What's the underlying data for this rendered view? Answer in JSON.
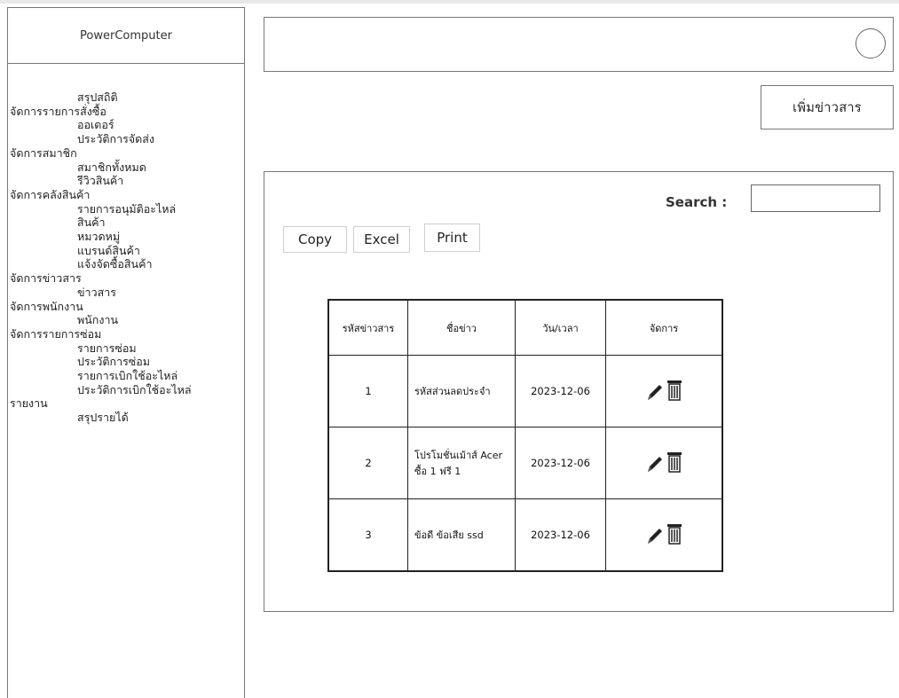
{
  "sidebar": {
    "brand": "PowerComputer",
    "menu": [
      {
        "label": "สรุปสถิติ",
        "level": "sub"
      },
      {
        "label": "จัดการรายการสั่งซื้อ",
        "level": "grp"
      },
      {
        "label": "ออเดอร์",
        "level": "sub"
      },
      {
        "label": "ประวัติการจัดส่ง",
        "level": "sub"
      },
      {
        "label": "จัดการสมาชิก",
        "level": "grp"
      },
      {
        "label": "สมาชิกทั้งหมด",
        "level": "sub"
      },
      {
        "label": "รีวิวสินค้า",
        "level": "sub"
      },
      {
        "label": "จัดการคลังสินค้า",
        "level": "grp"
      },
      {
        "label": "รายการอนุมัติอะไหล่",
        "level": "sub"
      },
      {
        "label": "สินค้า",
        "level": "sub"
      },
      {
        "label": "หมวดหมู่",
        "level": "sub"
      },
      {
        "label": "แบรนด์สินค้า",
        "level": "sub"
      },
      {
        "label": "แจ้งจัดซื้อสินค้า",
        "level": "sub"
      },
      {
        "label": "จัดการข่าวสาร",
        "level": "grp"
      },
      {
        "label": "ข่าวสาร",
        "level": "sub"
      },
      {
        "label": "จัดการพนักงาน",
        "level": "grp"
      },
      {
        "label": "พนักงาน",
        "level": "sub"
      },
      {
        "label": "จัดการรายการซ่อม",
        "level": "grp"
      },
      {
        "label": "รายการซ่อม",
        "level": "sub"
      },
      {
        "label": "ประวัติการซ่อม",
        "level": "sub"
      },
      {
        "label": "รายการเบิกใช้อะไหล่",
        "level": "sub"
      },
      {
        "label": "ประวัติการเบิกใช้อะไหล่",
        "level": "sub"
      },
      {
        "label": "รายงาน",
        "level": "grp"
      },
      {
        "label": "สรุปรายได้",
        "level": "sub"
      }
    ]
  },
  "header": {
    "avatar_icon": "avatar-circle"
  },
  "toolbar": {
    "add_news_label": "เพิ่มข่าวสาร"
  },
  "panel": {
    "search_label": "Search :",
    "search_value": "",
    "buttons": {
      "copy": "Copy",
      "excel": "Excel",
      "print": "Print"
    }
  },
  "table": {
    "headers": [
      "รหัสข่าวสาร",
      "ชื่อข่าว",
      "วัน/เวลา",
      "จัดการ"
    ],
    "rows": [
      {
        "id": "1",
        "title": "รหัสส่วนลดประจำ",
        "date": "2023-12-06"
      },
      {
        "id": "2",
        "title": "โปรโมชั่นเม้าส์ Acer ซื้อ 1 ฟรี 1",
        "date": "2023-12-06"
      },
      {
        "id": "3",
        "title": "ข้อดี ข้อเสีย ssd",
        "date": "2023-12-06"
      }
    ],
    "action_icons": [
      "pencil-icon",
      "trash-icon"
    ]
  }
}
